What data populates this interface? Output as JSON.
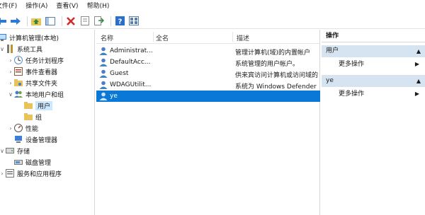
{
  "menu": {
    "items": [
      "文件(F)",
      "操作(A)",
      "查看(V)",
      "帮助(H)"
    ]
  },
  "toolbar": {
    "buttons": [
      "back-icon",
      "forward-icon",
      "up-folder-icon",
      "show-hide-tree-icon",
      "delete-icon",
      "properties-icon",
      "export-icon",
      "help-icon",
      "view-icon"
    ]
  },
  "tree": {
    "root": "计算机管理(本地)",
    "system_tools": "系统工具",
    "task_scheduler": "任务计划程序",
    "event_viewer": "事件查看器",
    "shared_folders": "共享文件夹",
    "local_users_groups": "本地用户和组",
    "users": "用户",
    "groups": "组",
    "performance": "性能",
    "device_manager": "设备管理器",
    "storage": "存储",
    "disk_management": "磁盘管理",
    "services_apps": "服务和应用程序"
  },
  "list": {
    "headers": {
      "name": "名称",
      "full_name": "全名",
      "description": "描述"
    },
    "rows": [
      {
        "name": "Administrat...",
        "full_name": "",
        "description": "管理计算机(域)的内置帐户"
      },
      {
        "name": "DefaultAcc...",
        "full_name": "",
        "description": "系统管理的用户帐户。"
      },
      {
        "name": "Guest",
        "full_name": "",
        "description": "供来宾访问计算机或访问域的"
      },
      {
        "name": "WDAGUtilit...",
        "full_name": "",
        "description": "系统为 Windows Defender"
      },
      {
        "name": "ye",
        "full_name": "",
        "description": ""
      }
    ],
    "selected_index": 4
  },
  "actions": {
    "title": "操作",
    "sections": [
      {
        "label": "用户",
        "item": "更多操作"
      },
      {
        "label": "ye",
        "item": "更多操作"
      }
    ]
  },
  "colors": {
    "selection": "#0a78d7",
    "section_header": "#d6e3f1",
    "tree_selected": "#cce8ff"
  }
}
